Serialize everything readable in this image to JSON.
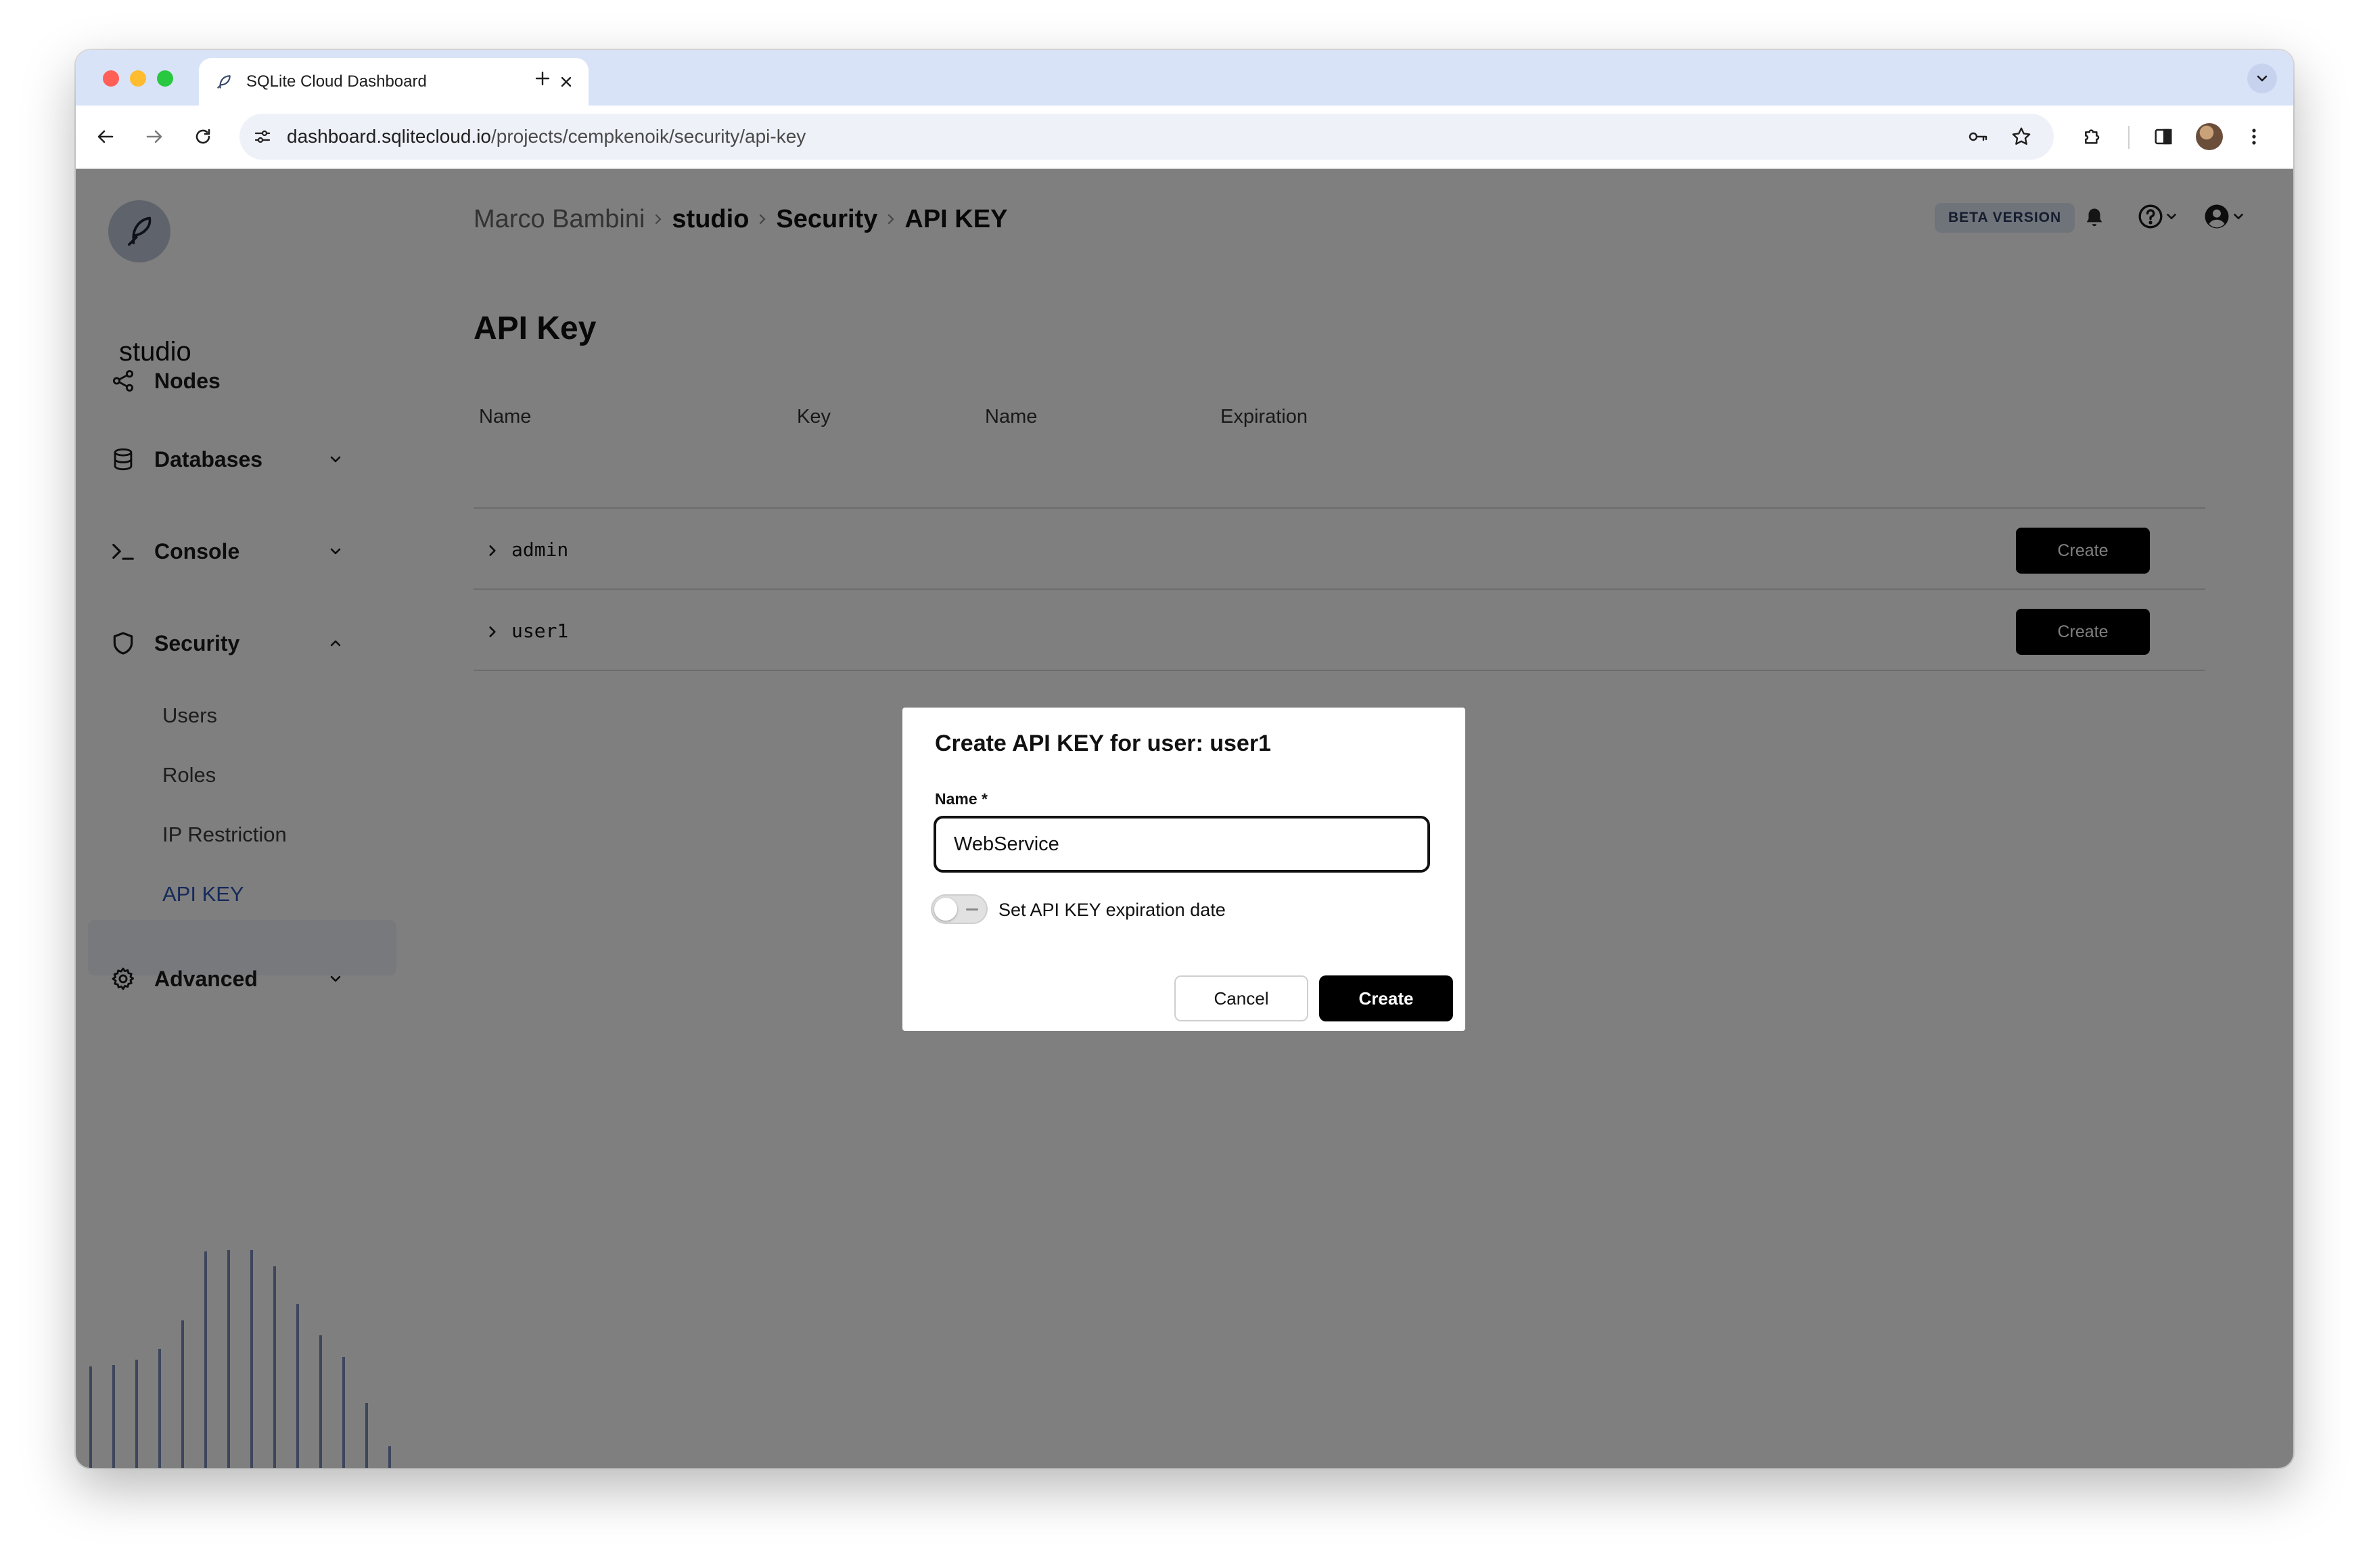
{
  "browser": {
    "tab_title": "SQLite Cloud Dashboard",
    "url_host": "dashboard.sqlitecloud.io",
    "url_path": "/projects/cempkenoik/security/api-key"
  },
  "sidebar": {
    "project_name": "studio",
    "items": [
      {
        "label": "Nodes",
        "icon": "nodes-icon"
      },
      {
        "label": "Databases",
        "icon": "database-icon"
      },
      {
        "label": "Console",
        "icon": "terminal-icon"
      },
      {
        "label": "Security",
        "icon": "shield-icon"
      },
      {
        "label": "Advanced",
        "icon": "gear-icon"
      }
    ],
    "security_sub": [
      "Users",
      "Roles",
      "IP Restriction",
      "API KEY"
    ],
    "active_sub": "API KEY"
  },
  "header": {
    "breadcrumb": [
      "Marco Bambini",
      "studio",
      "Security",
      "API KEY"
    ],
    "beta_badge": "BETA VERSION"
  },
  "main": {
    "title": "API Key",
    "columns": [
      "Name",
      "Key",
      "Name",
      "Expiration"
    ],
    "rows": [
      {
        "name": "admin",
        "action": "Create"
      },
      {
        "name": "user1",
        "action": "Create"
      }
    ]
  },
  "modal": {
    "title": "Create API KEY for user: user1",
    "name_label": "Name *",
    "name_value": "WebService",
    "toggle_label": "Set API KEY expiration date",
    "toggle_on": false,
    "cancel_label": "Cancel",
    "create_label": "Create"
  },
  "colors": {
    "accent_blue": "#2d54b4",
    "tab_strip": "#d9e3f8",
    "primary_button": "#000000"
  }
}
